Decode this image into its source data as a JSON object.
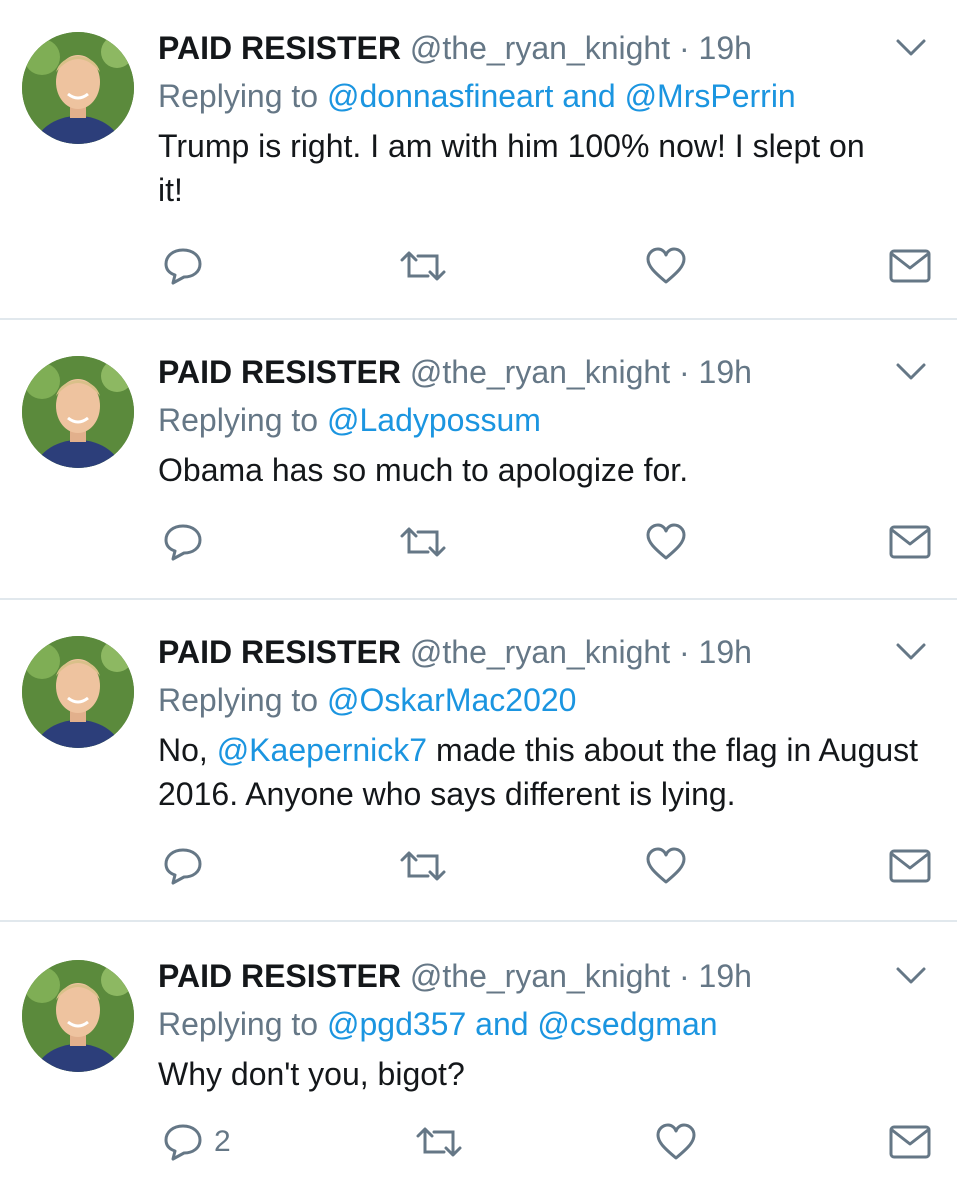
{
  "colors": {
    "name_text": "#14171a",
    "secondary_text": "#657786",
    "link": "#1b95e0",
    "divider": "#e1e8ed",
    "icon": "#657786"
  },
  "icons": {
    "reply": "reply-icon",
    "retweet": "retweet-icon",
    "like": "heart-icon",
    "dm": "mail-icon",
    "more": "chevron-down-icon"
  },
  "tweets": [
    {
      "name": "PAID RESISTER",
      "handle": "@the_ryan_knight",
      "separator": "·",
      "time": "19h",
      "replying_prefix": "Replying to",
      "reply_user1": "@donnasfineart",
      "reply_and": "and",
      "reply_user2": "@MrsPerrin",
      "text": "Trump is right. I am with him 100% now! I slept on it!",
      "reply_count": ""
    },
    {
      "name": "PAID RESISTER",
      "handle": "@the_ryan_knight",
      "separator": "·",
      "time": "19h",
      "replying_prefix": "Replying to",
      "reply_user1": "@Ladypossum",
      "text": "Obama has so much to apologize for.",
      "reply_count": ""
    },
    {
      "name": "PAID RESISTER",
      "handle": "@the_ryan_knight",
      "separator": "·",
      "time": "19h",
      "replying_prefix": "Replying to",
      "reply_user1": "@OskarMac2020",
      "text_prefix": "No,",
      "mention": "@Kaepernick7",
      "text_suffix": "made this about the flag in August 2016. Anyone who says different is lying.",
      "reply_count": ""
    },
    {
      "name": "PAID RESISTER",
      "handle": "@the_ryan_knight",
      "separator": "·",
      "time": "19h",
      "replying_prefix": "Replying to",
      "reply_user1": "@pgd357",
      "reply_and": "and",
      "reply_user2": "@csedgman",
      "text": "Why don't you, bigot?",
      "reply_count": "2"
    }
  ]
}
